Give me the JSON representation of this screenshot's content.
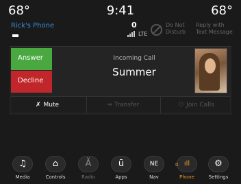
{
  "status": {
    "temp_left": "68°",
    "time": "9:41",
    "temp_right": "68°"
  },
  "phone": {
    "name": "Rick's Phone",
    "notification_count": "0",
    "network": "LTE",
    "do_not_disturb": "Do Not Disturb",
    "reply_text": "Reply with Text Message"
  },
  "call": {
    "answer_label": "Answer",
    "decline_label": "Decline",
    "status": "Incoming Call",
    "caller": "Summer"
  },
  "actions": {
    "mute": "Mute",
    "transfer": "Transfer",
    "join": "Join Calls"
  },
  "nav": {
    "items": [
      {
        "label": "Media",
        "icon": "music-note-icon",
        "glyph": "♫"
      },
      {
        "label": "Controls",
        "icon": "seat-icon",
        "glyph": "⌂"
      },
      {
        "label": "Radio",
        "icon": "antenna-icon",
        "glyph": "Ă"
      },
      {
        "label": "Apps",
        "icon": "apps-icon",
        "glyph": "ū"
      },
      {
        "label": "Nav",
        "icon": "compass-icon",
        "glyph": "NE"
      },
      {
        "label": "Phone",
        "icon": "phone-signal-icon",
        "glyph": "ıll",
        "badge": "0"
      },
      {
        "label": "Settings",
        "icon": "gear-icon",
        "glyph": "⚙"
      }
    ]
  },
  "colors": {
    "answer": "#4aa840",
    "decline": "#c0262a",
    "active": "#e49a2b",
    "phone_name": "#3a8ed8"
  }
}
